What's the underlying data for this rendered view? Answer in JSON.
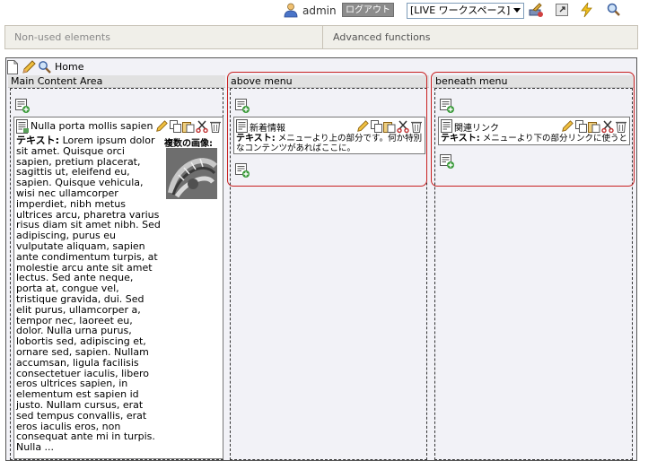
{
  "topbar": {
    "user_name": "admin",
    "logout_label": "ログアウト",
    "workspace_value": "[LIVE ワークスペース]",
    "icons": [
      "user-icon",
      "publish-icon",
      "popout-icon",
      "lightning-icon",
      "search-icon"
    ]
  },
  "panelbar": {
    "non_used": "Non-used elements",
    "advanced": "Advanced functions"
  },
  "page": {
    "home_label": "Home"
  },
  "areas": {
    "main": {
      "title": "Main Content Area",
      "component": {
        "title": "Nulla porta mollis sapien",
        "text_label": "テキスト:",
        "text": "Lorem ipsum dolor sit amet. Quisque orci sapien, pretium placerat, sagittis ut, eleifend eu, sapien. Quisque vehicula, wisi nec ullamcorper imperdiet, nibh metus ultrices arcu, pharetra varius risus diam sit amet nibh. Sed adipiscing, purus eu vulputate aliquam, sapien ante condimentum turpis, at molestie arcu ante sit amet lectus. Sed ante neque, porta at, congue vel, tristique gravida, dui. Sed elit purus, ullamcorper a, tempor nec, laoreet eu, dolor. Nulla urna purus, lobortis sed, adipiscing et, ornare sed, sapien. Nullam accumsan, ligula facilisis consectetuer iaculis, libero eros ultrices sapien, in elementum est sapien id justo. Nullam cursus, erat sed tempus convallis, erat eros iaculis eros, non consequat ante mi in turpis. Nulla ...",
        "image_label": "複数の画像:"
      }
    },
    "above": {
      "title": "above menu",
      "component": {
        "title": "新着情報",
        "text_label": "テキスト:",
        "text": "メニューより上の部分です。何か特別なコンテンツがあればここに。"
      }
    },
    "beneath": {
      "title": "beneath menu",
      "component": {
        "title": "関連リンク",
        "text_label": "テキスト:",
        "text": "メニューより下の部分リンクに使うとか"
      }
    }
  },
  "colors": {
    "red_outline": "#c82020",
    "logout_bg": "#8c8c8c",
    "frame_bg": "#f2f2f7"
  }
}
